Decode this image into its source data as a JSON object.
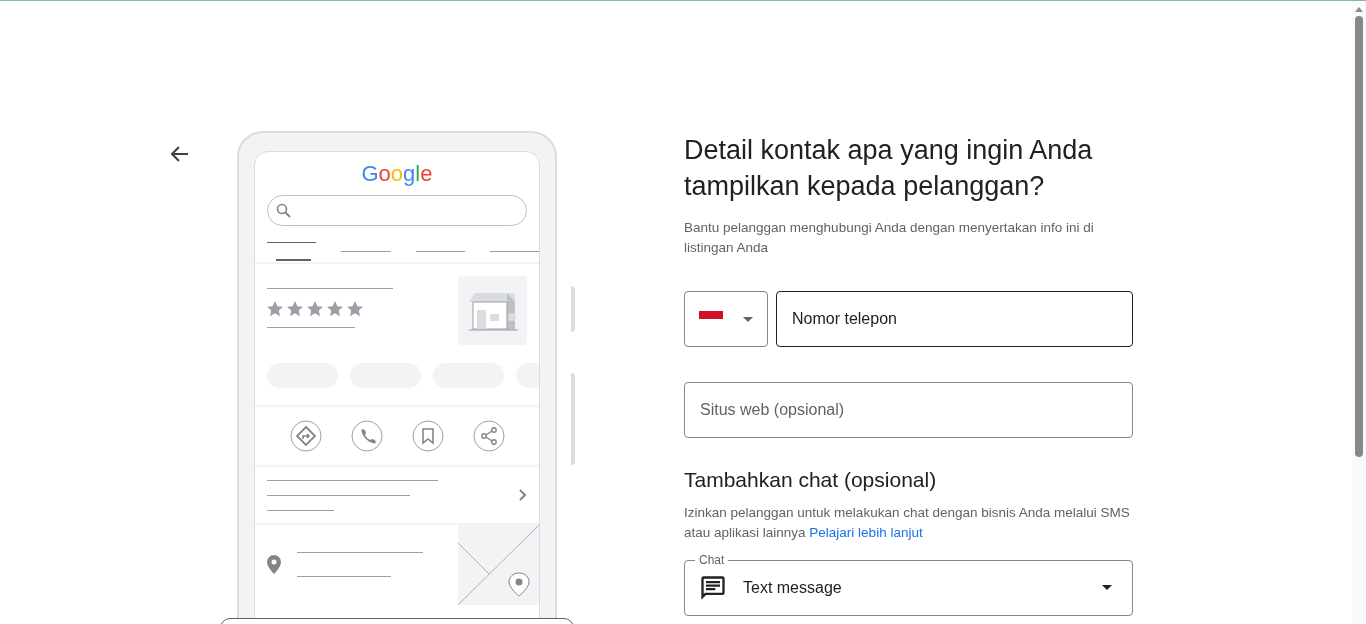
{
  "illustration": {
    "brand": "Google"
  },
  "heading": "Detail kontak apa yang ingin Anda tampilkan kepada pelanggan?",
  "subtitle": "Bantu pelanggan menghubungi Anda dengan menyertakan info ini di listingan Anda",
  "phone_field": {
    "placeholder": "Nomor telepon",
    "focused": true
  },
  "website_field": {
    "placeholder": "Situs web (opsional)",
    "focused": false
  },
  "chat_section": {
    "title": "Tambahkan chat (opsional)",
    "description": "Izinkan pelanggan untuk melakukan chat dengan bisnis Anda melalui SMS atau aplikasi lainnya",
    "link": "Pelajari lebih lanjut",
    "select": {
      "label": "Chat",
      "value": "Text message"
    }
  }
}
